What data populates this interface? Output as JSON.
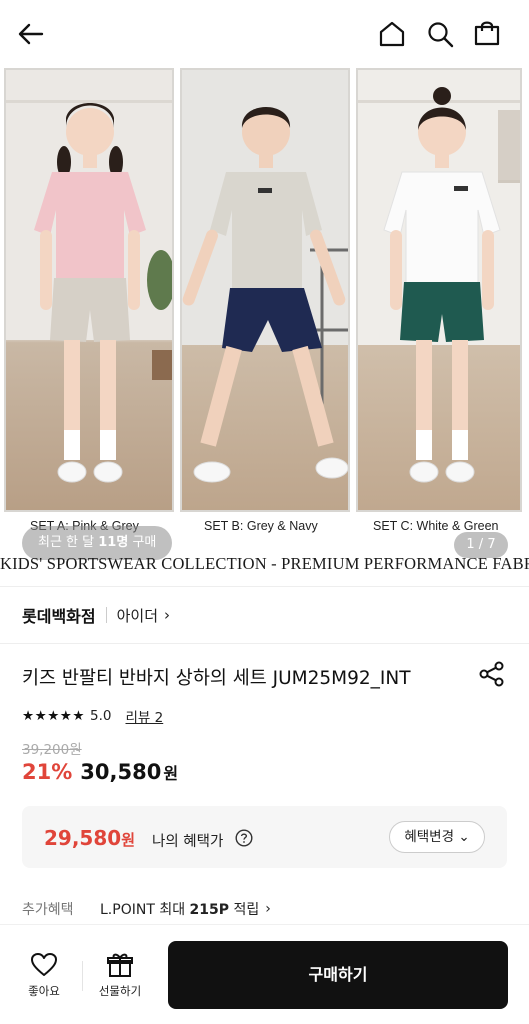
{
  "header": {
    "back_icon": "arrow-left-icon",
    "home_icon": "home-icon",
    "search_icon": "search-icon",
    "bag_icon": "shopping-bag-icon"
  },
  "gallery": {
    "captions": [
      "SET A: Pink & Grey",
      "SET B: Grey & Navy",
      "SET C: White & Green"
    ],
    "recent_prefix": "최근 한 달 ",
    "recent_count": "11명",
    "recent_suffix": " 구매",
    "page_indicator": "1 / 7",
    "collection_text": "KIDS' SPORTSWEAR COLLECTION - PREMIUM PERFORMANCE FABRIC",
    "colors": {
      "pink_shirt": "#f1c4c9",
      "beige_shorts": "#d6d0c7",
      "grey_shirt": "#d9d6ce",
      "navy_shorts": "#1f2a52",
      "white_shirt": "#fbfbfb",
      "green_shorts": "#1f5a50"
    }
  },
  "brand": {
    "store": "롯데백화점",
    "sub": "아이더",
    "chevron": "›"
  },
  "product": {
    "title": "키즈 반팔티 반바지 상하의 세트 JUM25M92_INT",
    "share_icon": "share-icon",
    "stars": "★★★★★",
    "rating": "5.0",
    "review": "리뷰 2",
    "original_price": "39,200원",
    "discount": "21%",
    "price": "30,580",
    "price_unit": "원"
  },
  "benefit": {
    "price": "29,580",
    "unit": "원",
    "label": "나의 혜택가",
    "help_icon": "question-circle-icon",
    "button": "혜택변경 ⌄"
  },
  "extra": {
    "label": "추가혜택",
    "text_prefix": "L.POINT 최대 ",
    "text_bold": "215P",
    "text_suffix": " 적립",
    "chevron": "›"
  },
  "bottom": {
    "like_label": "좋아요",
    "gift_label": "선물하기",
    "buy_label": "구매하기"
  }
}
